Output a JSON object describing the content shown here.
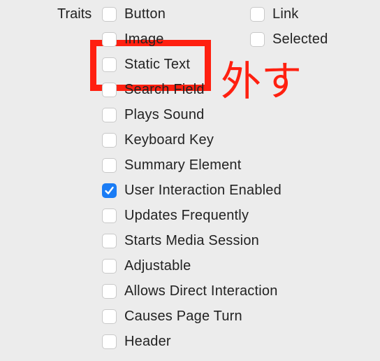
{
  "traits_label": "Traits",
  "left": [
    {
      "label": "Button",
      "checked": false
    },
    {
      "label": "Image",
      "checked": false
    },
    {
      "label": "Static Text",
      "checked": false
    },
    {
      "label": "Search Field",
      "checked": false
    },
    {
      "label": "Plays Sound",
      "checked": false
    },
    {
      "label": "Keyboard Key",
      "checked": false
    },
    {
      "label": "Summary Element",
      "checked": false
    },
    {
      "label": "User Interaction Enabled",
      "checked": true
    },
    {
      "label": "Updates Frequently",
      "checked": false
    },
    {
      "label": "Starts Media Session",
      "checked": false
    },
    {
      "label": "Adjustable",
      "checked": false
    },
    {
      "label": "Allows Direct Interaction",
      "checked": false
    },
    {
      "label": "Causes Page Turn",
      "checked": false
    },
    {
      "label": "Header",
      "checked": false
    }
  ],
  "right": [
    {
      "label": "Link",
      "checked": false
    },
    {
      "label": "Selected",
      "checked": false
    }
  ],
  "annotation": "外す",
  "colors": {
    "accent": "#1a7cf5",
    "annotation": "#ff2010"
  }
}
